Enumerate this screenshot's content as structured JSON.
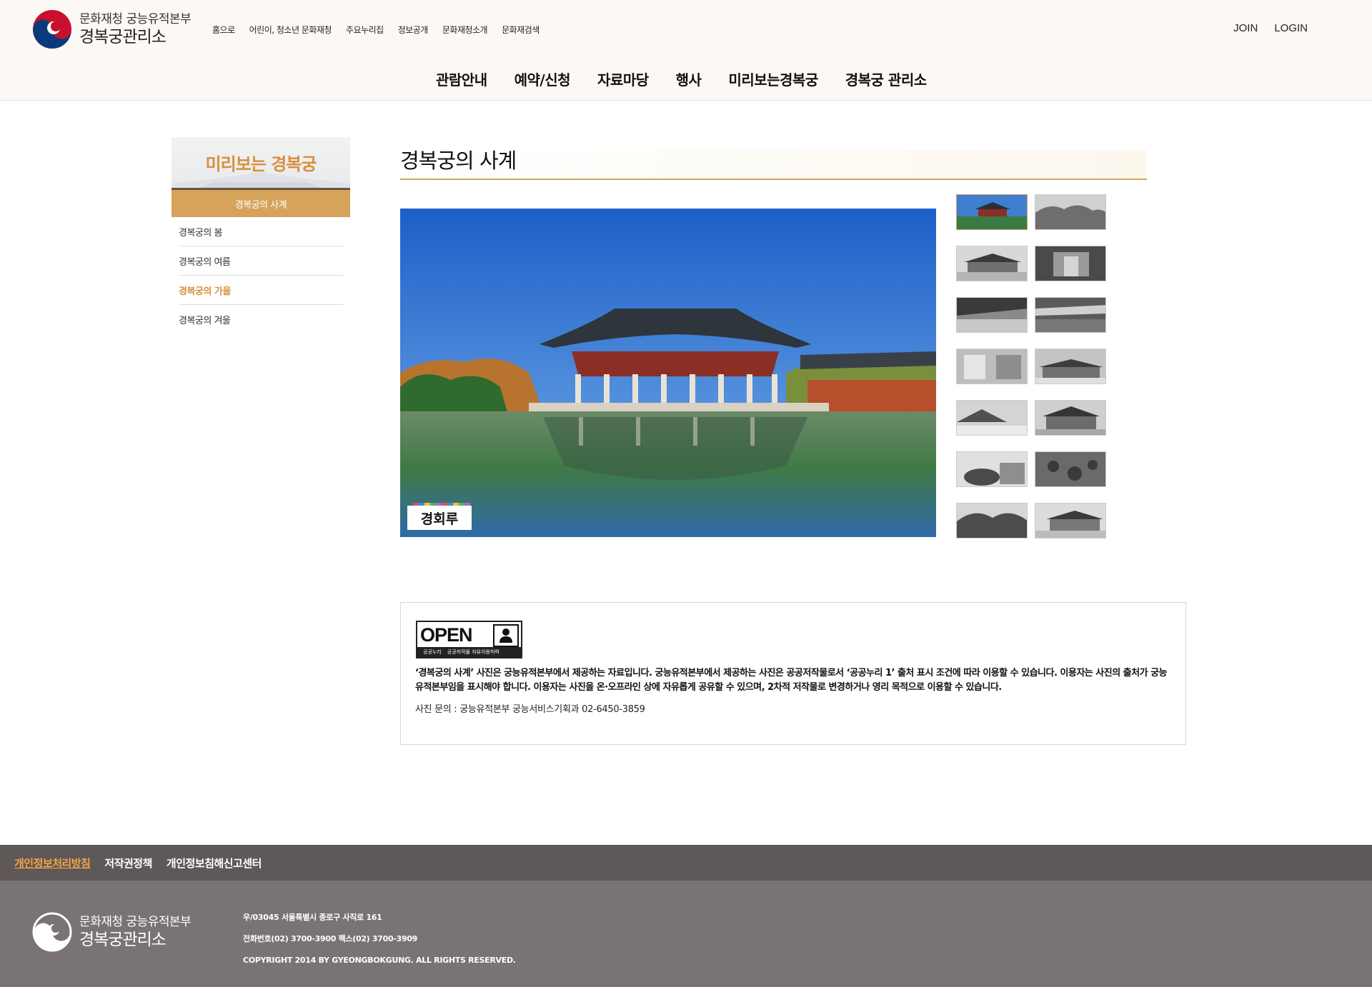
{
  "header": {
    "org_line1": "문화재청 궁능유적본부",
    "org_line2": "경복궁관리소",
    "util_nav": [
      "홈으로",
      "어린이, 청소년 문화재청",
      "주요누리집",
      "정보공개",
      "문화재청소개",
      "문화재검색"
    ],
    "join": "JOIN",
    "login": "LOGIN",
    "gnb": [
      "관람안내",
      "예약/신청",
      "자료마당",
      "행사",
      "미리보는경복궁",
      "경복궁 관리소"
    ]
  },
  "sidebar": {
    "title": "미리보는 경복궁",
    "section": "경복궁의 사계",
    "items": [
      {
        "label": "경복궁의 봄",
        "active": false
      },
      {
        "label": "경복궁의 여름",
        "active": false
      },
      {
        "label": "경복궁의 가을",
        "active": true
      },
      {
        "label": "경복궁의 겨울",
        "active": false
      }
    ]
  },
  "content": {
    "title": "경복궁의 사계",
    "photo_caption": "경회루",
    "thumbnail_count": 14,
    "selected_thumbnail": 1
  },
  "license": {
    "badge_open": "OPEN",
    "badge_sub1": "공공누리",
    "badge_sub2": "공공저작물 자유이용허락",
    "badge_mark": "출처표시",
    "notice": "‘경복궁의 사계’ 사진은 궁능유적본부에서 제공하는 자료입니다. 궁능유적본부에서 제공하는 사진은 공공저작물로서 ‘공공누리 1’ 출처 표시 조건에 따라 이용할 수 있습니다. 이용자는 사진의 출처가 궁능유적본부임을 표시해야 합니다. 이용자는 사진을 온·오프라인 상에 자유롭게 공유할 수 있으며, 2차적 저작물로 변경하거나 영리 목적으로 이용할 수 있습니다.",
    "contact": "사진 문의 : 궁능유적본부 궁능서비스기획과 02-6450-3859"
  },
  "footer": {
    "links": [
      "개인정보처리방침",
      "저작권정책",
      "개인정보침해신고센터"
    ],
    "org_line1": "문화재청 궁능유적본부",
    "org_line2": "경복궁관리소",
    "address": "우/03045 서울특별시 종로구 사직로 161",
    "phone": "전화번호(02) 3700-3900 팩스(02) 3700-3909",
    "copyright": "COPYRIGHT 2014 BY GYEONGBOKGUNG. ALL RIGHTS RESERVED."
  },
  "colors": {
    "accent": "#d6a35a",
    "accent_text": "#d98f3b",
    "footer_dark": "#5e5858",
    "footer": "#797373",
    "header_bg": "#fcf8f6"
  }
}
